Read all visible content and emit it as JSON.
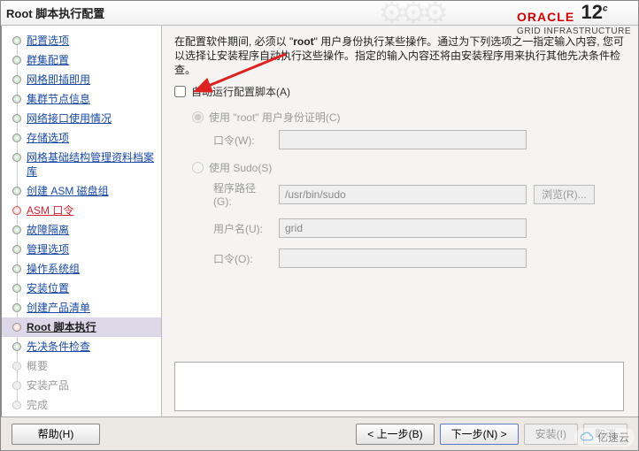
{
  "header": {
    "title": "Root 脚本执行配置",
    "brand_top": "ORACLE",
    "brand_sub": "GRID INFRASTRUCTURE",
    "brand_ver": "12"
  },
  "sidebar": {
    "items": [
      {
        "label": "配置选项",
        "state": "done"
      },
      {
        "label": "群集配置",
        "state": "done"
      },
      {
        "label": "网格即插即用",
        "state": "done"
      },
      {
        "label": "集群节点信息",
        "state": "done"
      },
      {
        "label": "网络接口使用情况",
        "state": "done"
      },
      {
        "label": "存储选项",
        "state": "done"
      },
      {
        "label": "网格基础结构管理资料档案库",
        "state": "done"
      },
      {
        "label": "创建 ASM 磁盘组",
        "state": "done"
      },
      {
        "label": "ASM 口令",
        "state": "asm"
      },
      {
        "label": "故障隔离",
        "state": "done"
      },
      {
        "label": "管理选项",
        "state": "done"
      },
      {
        "label": "操作系统组",
        "state": "done"
      },
      {
        "label": "安装位置",
        "state": "done"
      },
      {
        "label": "创建产品清单",
        "state": "done"
      },
      {
        "label": "Root 脚本执行",
        "state": "selected"
      },
      {
        "label": "先决条件检查",
        "state": "next"
      },
      {
        "label": "概要",
        "state": "disabled"
      },
      {
        "label": "安装产品",
        "state": "disabled"
      },
      {
        "label": "完成",
        "state": "disabled"
      }
    ]
  },
  "content": {
    "description_pre": "在配置软件期间, 必须以 \"",
    "description_bold": "root",
    "description_post": "\" 用户身份执行某些操作。通过为下列选项之一指定输入内容, 您可以选择让安装程序自动执行这些操作。指定的输入内容还将由安装程序用来执行其他先决条件检查。",
    "auto_run_label": "自动运行配置脚本(A)",
    "auto_run_checked": false,
    "use_root_label": "使用 \"root\" 用户身份证明(C)",
    "password_label": "口令(W):",
    "password_value": "",
    "use_sudo_label": "使用 Sudo(S)",
    "program_path_label": "程序路径(G):",
    "program_path_value": "/usr/bin/sudo",
    "browse_label": "浏览(R)...",
    "username_label": "用户名(U):",
    "username_value": "grid",
    "sudo_password_label": "口令(O):",
    "sudo_password_value": ""
  },
  "footer": {
    "help": "帮助(H)",
    "back": "< 上一步(B)",
    "next": "下一步(N) >",
    "install": "安装(I)",
    "cancel": "取消"
  },
  "watermark": "亿速云"
}
